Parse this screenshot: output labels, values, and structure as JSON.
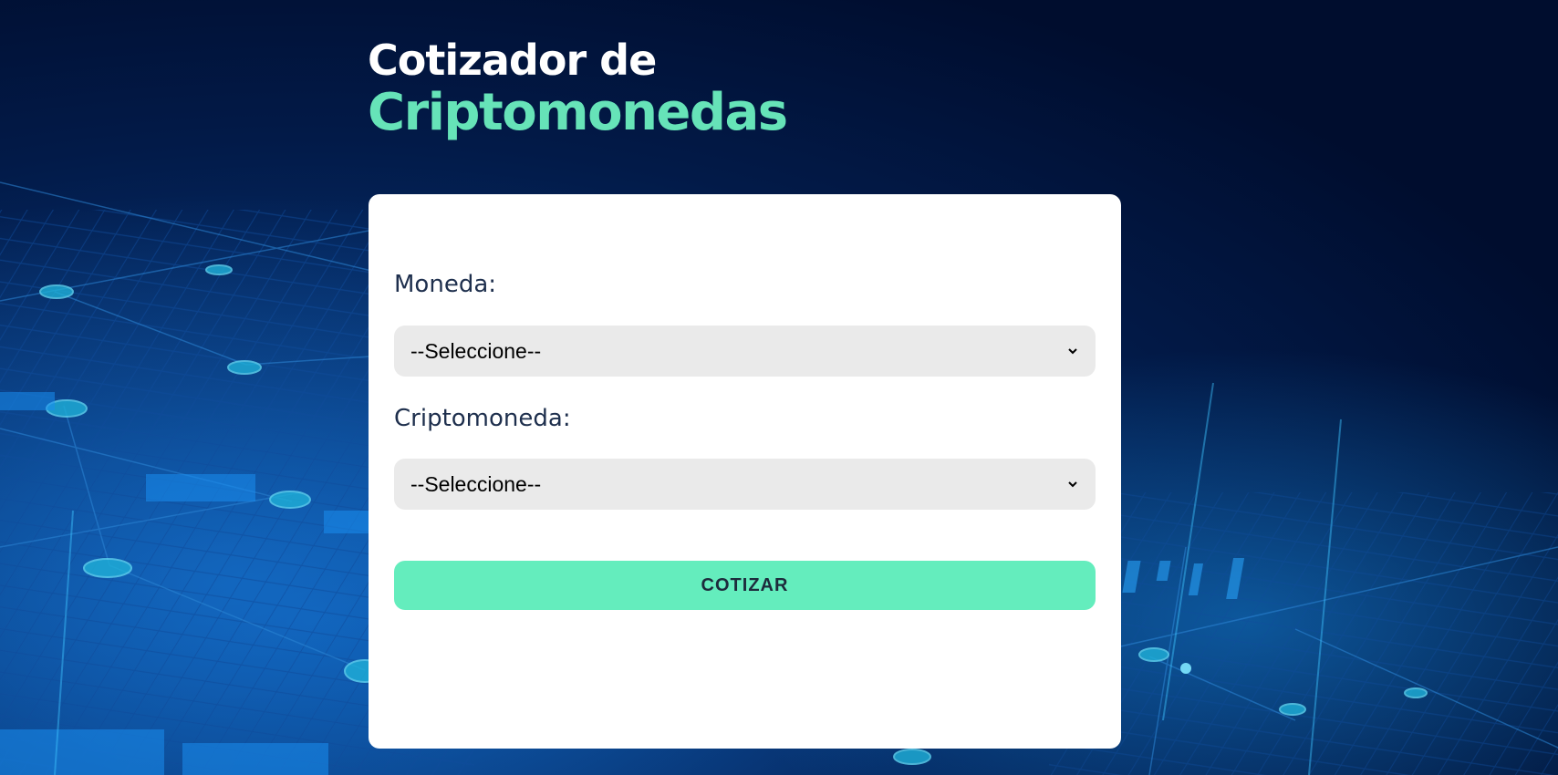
{
  "header": {
    "title_line_1": "Cotizador de",
    "title_line_2": "Criptomonedas"
  },
  "form": {
    "currency": {
      "label": "Moneda:",
      "selected": "--Seleccione--"
    },
    "crypto": {
      "label": "Criptomoneda:",
      "selected": "--Seleccione--"
    },
    "submit_label": "COTIZAR"
  },
  "colors": {
    "background": "#000d2e",
    "accent": "#66e3b8",
    "button": "#64edbd",
    "card": "#ffffff",
    "select_bg": "#eaeaea",
    "label_text": "#1e2f4d"
  },
  "icons": {
    "select_chevron": "chevron-down-icon"
  }
}
